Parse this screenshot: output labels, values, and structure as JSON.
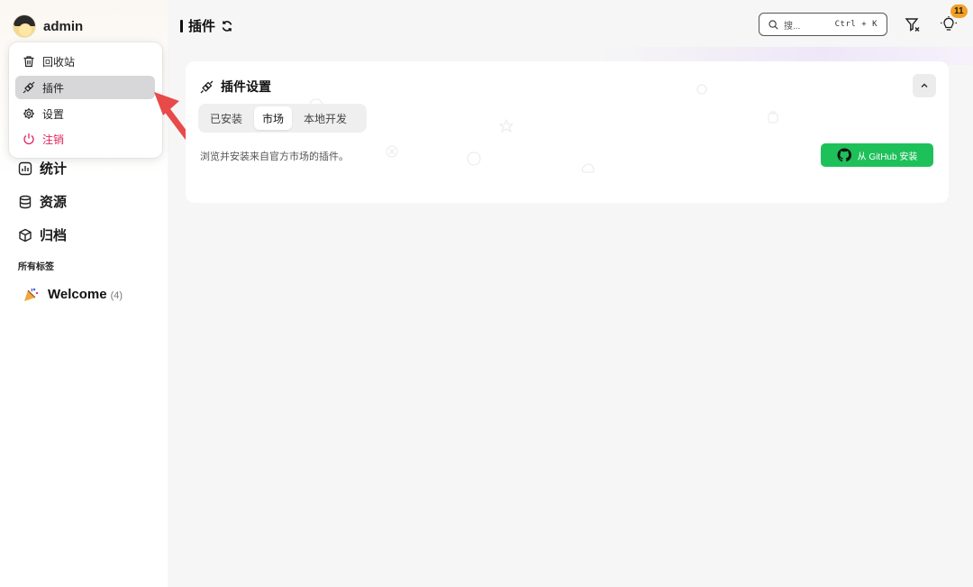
{
  "sidebar": {
    "user": {
      "name": "admin"
    },
    "nav": [
      {
        "label": "统计",
        "icon": "chart-icon"
      },
      {
        "label": "资源",
        "icon": "database-icon"
      },
      {
        "label": "归档",
        "icon": "box-icon"
      }
    ],
    "tags_title": "所有标签",
    "tags": [
      {
        "label": "Welcome",
        "count": "(4)",
        "icon": "party-popper-icon"
      }
    ]
  },
  "user_menu": {
    "items": [
      {
        "label": "回收站",
        "icon": "trash-icon"
      },
      {
        "label": "插件",
        "icon": "plug-icon",
        "active": true
      },
      {
        "label": "设置",
        "icon": "gear-icon"
      },
      {
        "label": "注销",
        "icon": "power-icon",
        "danger": true
      }
    ]
  },
  "header": {
    "title": "插件",
    "search": {
      "placeholder": "搜...",
      "shortcut": "Ctrl + K"
    },
    "notification_count": "11"
  },
  "plugin_card": {
    "title": "插件设置",
    "tabs": [
      {
        "label": "已安装"
      },
      {
        "label": "市场",
        "active": true
      },
      {
        "label": "本地开发"
      }
    ],
    "description": "浏览并安装来自官方市场的插件。",
    "github_install_label": "从 GitHub 安装"
  },
  "colors": {
    "accent_green": "#1ec05a",
    "danger": "#e0245e",
    "badge": "#f0a12a",
    "annotation_arrow": "#e84a4a"
  }
}
